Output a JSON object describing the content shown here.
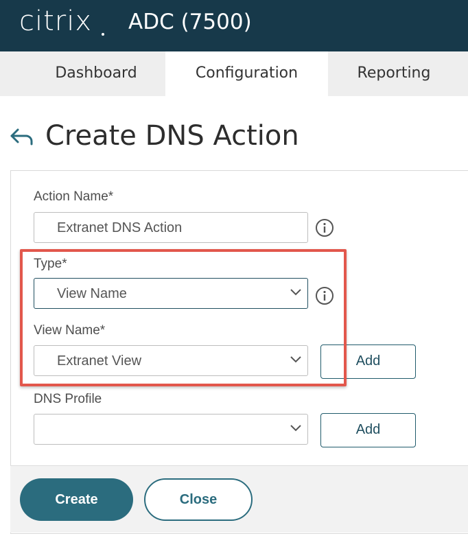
{
  "header": {
    "brand": "citrix",
    "product": "ADC (7500)"
  },
  "tabs": [
    {
      "label": "Dashboard"
    },
    {
      "label": "Configuration",
      "active": true
    },
    {
      "label": "Reporting"
    }
  ],
  "page": {
    "title": "Create DNS Action"
  },
  "form": {
    "action_name": {
      "label": "Action Name*",
      "value": "Extranet DNS Action"
    },
    "type": {
      "label": "Type*",
      "value": "View Name"
    },
    "view_name": {
      "label": "View Name*",
      "value": "Extranet View",
      "add_label": "Add"
    },
    "dns_profile": {
      "label": "DNS Profile",
      "value": "",
      "add_label": "Add"
    }
  },
  "footer": {
    "create_label": "Create",
    "close_label": "Close"
  },
  "colors": {
    "header_bg": "#17394a",
    "accent": "#2b6c7e",
    "highlight": "#e2574c"
  },
  "icons": {
    "back": "back-arrow-icon",
    "info": "info-icon",
    "dropdown": "chevron-down-icon"
  }
}
